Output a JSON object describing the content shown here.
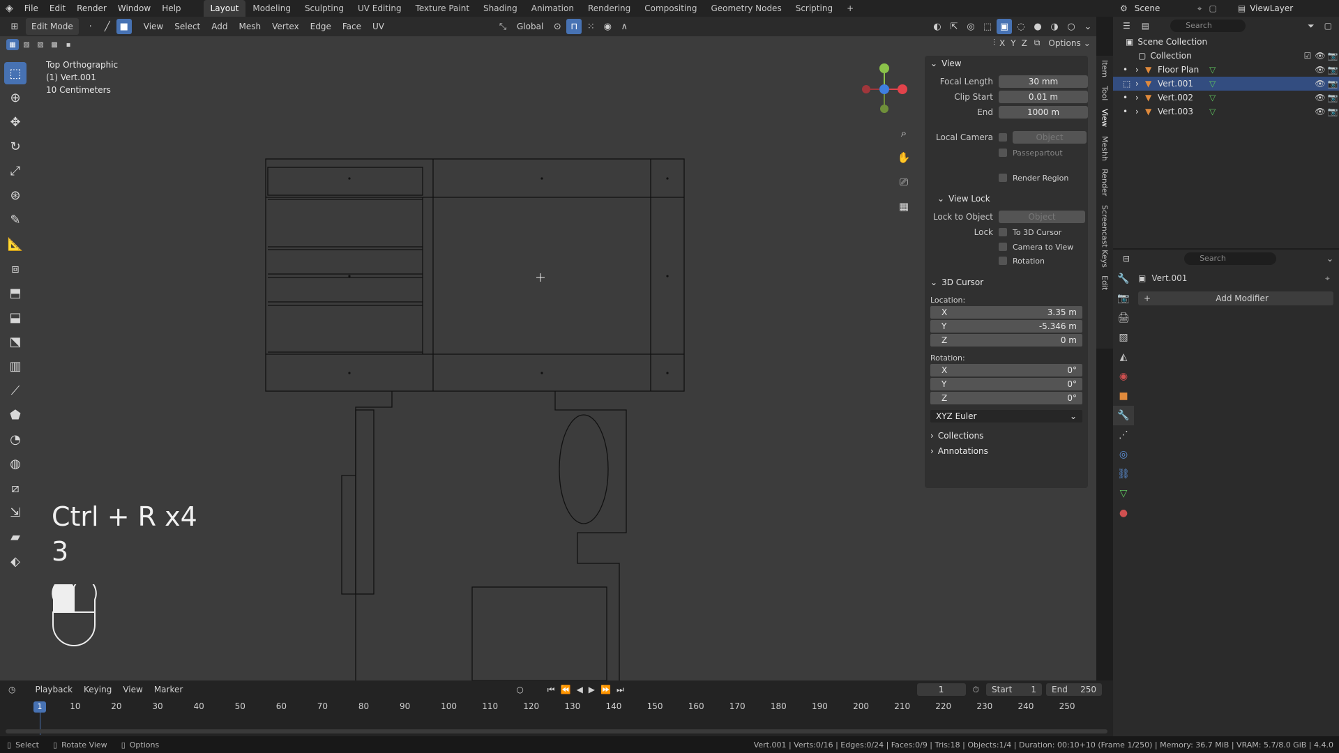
{
  "menus": [
    "File",
    "Edit",
    "Render",
    "Window",
    "Help"
  ],
  "workspaces": [
    "Layout",
    "Modeling",
    "Sculpting",
    "UV Editing",
    "Texture Paint",
    "Shading",
    "Animation",
    "Rendering",
    "Compositing",
    "Geometry Nodes",
    "Scripting"
  ],
  "scene": {
    "label": "Scene",
    "viewlayer": "ViewLayer"
  },
  "header": {
    "mode": "Edit Mode",
    "menus": [
      "View",
      "Select",
      "Add",
      "Mesh",
      "Vertex",
      "Edge",
      "Face",
      "UV"
    ],
    "orientation": "Global",
    "options": "Options",
    "axes": [
      "X",
      "Y",
      "Z"
    ]
  },
  "viewport": {
    "view_name": "Top Orthographic",
    "object": "(1) Vert.001",
    "scale": "10 Centimeters",
    "shortcut": "Ctrl + R x4",
    "shortcut_count": "3"
  },
  "npanel": {
    "view_title": "View",
    "focal_length_label": "Focal Length",
    "focal_length": "30 mm",
    "clip_start_label": "Clip Start",
    "clip_start": "0.01 m",
    "end_label": "End",
    "end": "1000 m",
    "local_camera_label": "Local Camera",
    "object_placeholder": "Object",
    "passepartout": "Passepartout",
    "render_region": "Render Region",
    "view_lock_title": "View Lock",
    "lock_to_object_label": "Lock to Object",
    "lock_label": "Lock",
    "to_3d_cursor": "To 3D Cursor",
    "camera_to_view": "Camera to View",
    "rotation_lock": "Rotation",
    "cursor_title": "3D Cursor",
    "location_label": "Location:",
    "loc_x": "3.35 m",
    "loc_y": "-5.346 m",
    "loc_z": "0 m",
    "rotation_label": "Rotation:",
    "rot_x": "0°",
    "rot_y": "0°",
    "rot_z": "0°",
    "euler": "XYZ Euler",
    "collections": "Collections",
    "annotations": "Annotations",
    "axis_x": "X",
    "axis_y": "Y",
    "axis_z": "Z",
    "tabs": [
      "Item",
      "Tool",
      "View",
      "Meshh",
      "Render",
      "Screencast Keys",
      "Edit"
    ]
  },
  "outliner": {
    "search": "Search",
    "scene_collection": "Scene Collection",
    "collection": "Collection",
    "items": [
      {
        "name": "Floor Plan",
        "selected": false
      },
      {
        "name": "Vert.001",
        "selected": true
      },
      {
        "name": "Vert.002",
        "selected": false
      },
      {
        "name": "Vert.003",
        "selected": false
      }
    ]
  },
  "properties": {
    "search": "Search",
    "object": "Vert.001",
    "add_modifier": "Add Modifier"
  },
  "timeline": {
    "menus": [
      "Playback",
      "Keying",
      "View",
      "Marker"
    ],
    "current_frame": "1",
    "start_label": "Start",
    "start": "1",
    "end_label": "End",
    "end": "250",
    "ticks": [
      "1",
      "10",
      "20",
      "30",
      "40",
      "50",
      "60",
      "70",
      "80",
      "90",
      "100",
      "110",
      "120",
      "130",
      "140",
      "150",
      "160",
      "170",
      "180",
      "190",
      "200",
      "210",
      "220",
      "230",
      "240",
      "250"
    ]
  },
  "status": {
    "select": "Select",
    "rotate": "Rotate View",
    "options": "Options",
    "stats": "Vert.001 | Verts:0/16 | Edges:0/24 | Faces:0/9 | Tris:18 | Objects:1/4 | Duration: 00:10+10 (Frame 1/250) | Memory: 36.7 MiB | VRAM: 5.7/8.0 GiB | 4.4.0"
  },
  "colors": {
    "accent": "#4772b3",
    "gizmo_x": "#e2434b",
    "gizmo_y": "#8bc34a",
    "gizmo_z": "#3f7fe0"
  }
}
